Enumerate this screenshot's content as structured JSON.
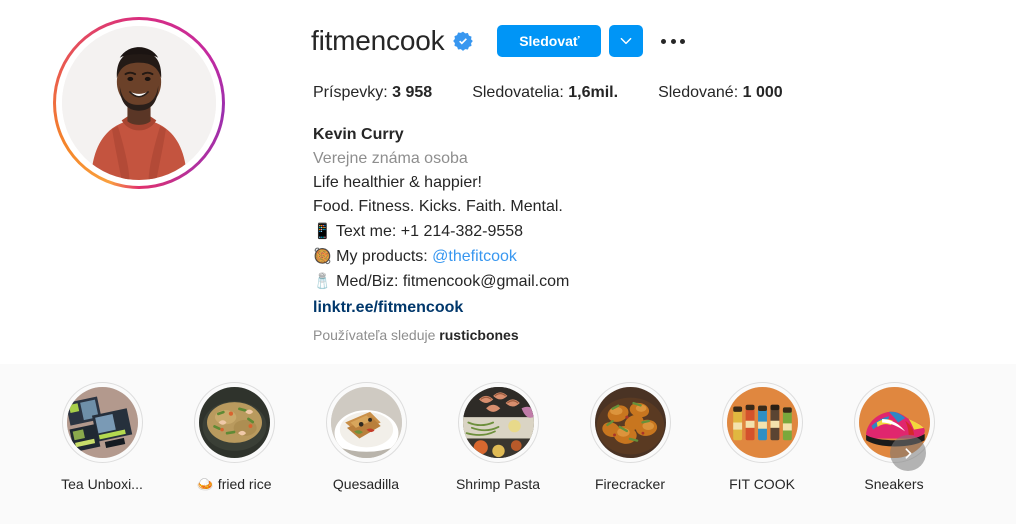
{
  "profile": {
    "username": "fitmencook",
    "verified_icon": "verified-badge-icon",
    "follow_button_label": "Sledovať",
    "chevron_icon": "chevron-down-icon",
    "more_icon": "more-options-icon",
    "avatar_alt": "fitmencook profile photo",
    "story_ring_colors": [
      "#f9a03f",
      "#e95950",
      "#d92e7f",
      "#9b2fae"
    ],
    "accent_color": "#0095f6"
  },
  "stats": [
    {
      "label": "Príspevky:",
      "value": "3 958",
      "name": "posts"
    },
    {
      "label": "Sledovatelia:",
      "value": "1,6mil.",
      "name": "followers"
    },
    {
      "label": "Sledované:",
      "value": "1 000",
      "name": "following"
    }
  ],
  "bio": {
    "full_name": "Kevin Curry",
    "category": "Verejne známa osoba",
    "lines": [
      {
        "emoji": "",
        "text": "Life healthier & happier!"
      },
      {
        "emoji": "",
        "text": "Food. Fitness. Kicks. Faith. Mental."
      },
      {
        "emoji": "📱",
        "text": "Text me: +1 214-382-9558"
      },
      {
        "emoji": "🥘",
        "text": "My products: ",
        "mention": "@thefitcook"
      },
      {
        "emoji": "🧂",
        "text": "Med/Biz: fitmencook@gmail.com"
      }
    ],
    "external_link": "linktr.ee/fitmencook",
    "link_color": "#00376b",
    "mention_color": "#3897f0"
  },
  "followed_by": {
    "prefix": "Používateľa sleduje",
    "names": "rusticbones"
  },
  "highlights": {
    "next_icon": "chevron-right-icon",
    "items": [
      {
        "label": "Tea Unboxi...",
        "cover": "tea-boxes",
        "bg": "#b09a90"
      },
      {
        "label": "🍛 fried rice",
        "cover": "fried-rice",
        "bg": "#3c4038"
      },
      {
        "label": "Quesadilla",
        "cover": "quesadilla",
        "bg": "#d8d4cc"
      },
      {
        "label": "Shrimp Pasta",
        "cover": "shrimp-pasta",
        "bg": "#6d6a63"
      },
      {
        "label": "Firecracker",
        "cover": "firecracker",
        "bg": "#7a4a2a"
      },
      {
        "label": "FIT COOK",
        "cover": "fit-cook",
        "bg": "#e08b४2"
      },
      {
        "label": "Sneakers",
        "cover": "sneakers",
        "bg": "#e08b42"
      }
    ]
  }
}
